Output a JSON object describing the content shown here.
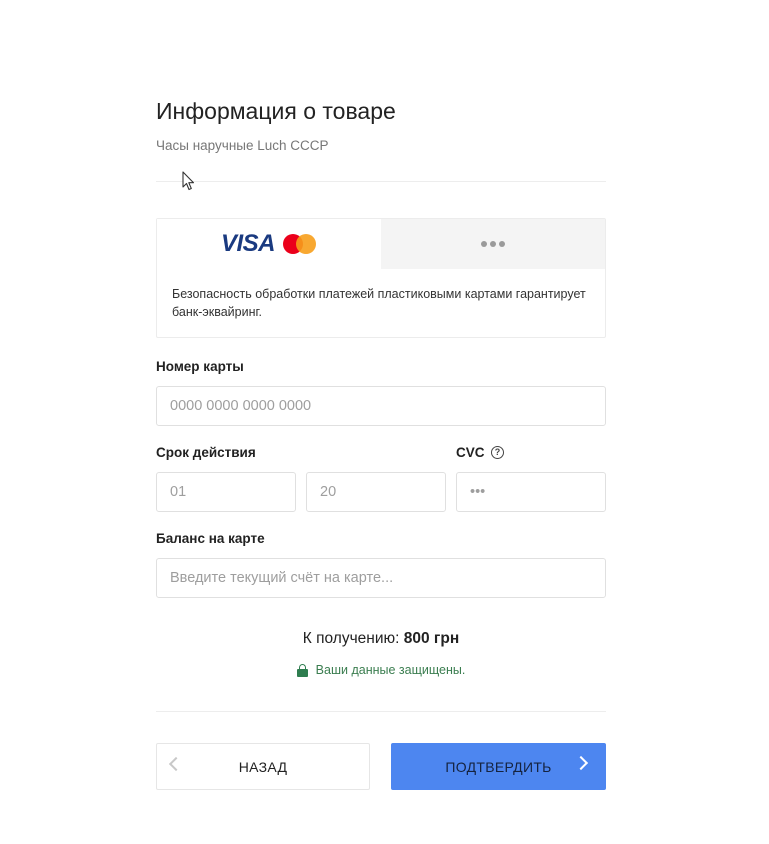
{
  "header": {
    "title": "Информация о товаре",
    "subtitle": "Часы наручные Luch СССР"
  },
  "payment_methods": {
    "card_tab": {
      "brand1": "VISA",
      "brand2_icon": "mastercard-icon"
    },
    "other_tab": {
      "icon": "more-dots-icon"
    },
    "note": "Безопасность обработки платежей пластиковыми картами гарантирует банк-эквайринг."
  },
  "form": {
    "card_number": {
      "label": "Номер карты",
      "placeholder": "0000 0000 0000 0000",
      "value": ""
    },
    "expiry": {
      "label": "Срок действия",
      "month_placeholder": "01",
      "year_placeholder": "20"
    },
    "cvc": {
      "label": "CVC",
      "placeholder": "•••",
      "help_icon": "question-circle-icon"
    },
    "balance": {
      "label": "Баланс на карте",
      "placeholder": "Введите текущий счёт на карте..."
    }
  },
  "summary": {
    "total_label": "К получению:",
    "total_value": "800 грн",
    "secure_text": "Ваши данные защищены.",
    "secure_icon": "lock-icon"
  },
  "actions": {
    "back_label": "НАЗАД",
    "confirm_label": "ПОДТВЕРДИТЬ"
  },
  "colors": {
    "accent": "#4d86f0",
    "secure_green": "#3a7d4f",
    "visa_blue": "#1a3a80"
  }
}
